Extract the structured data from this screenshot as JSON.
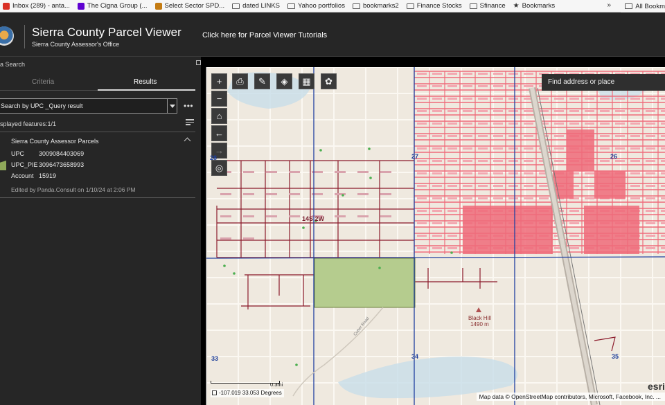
{
  "browser": {
    "bookmarks": [
      {
        "label": "Inbox (289) - anta...",
        "icon": "mail-icon",
        "color": "#d93025"
      },
      {
        "label": "The Cigna Group (...",
        "icon": "yahoo-icon",
        "color": "#5f01d1"
      },
      {
        "label": "Select Sector SPD...",
        "icon": "globe-icon",
        "color": "#c47b12"
      },
      {
        "label": "dated LINKS",
        "icon": "folder-icon",
        "color": "#555555"
      },
      {
        "label": "Yahoo portfolios",
        "icon": "folder-icon",
        "color": "#555555"
      },
      {
        "label": "bookmarks2",
        "icon": "folder-icon",
        "color": "#555555"
      },
      {
        "label": "Finance Stocks",
        "icon": "folder-icon",
        "color": "#555555"
      },
      {
        "label": "Sfinance",
        "icon": "folder-icon",
        "color": "#555555"
      },
      {
        "label": "Bookmarks",
        "icon": "star-icon",
        "color": "#333333"
      }
    ],
    "more_label": "»",
    "all_bookmarks_label": "All Bookm"
  },
  "header": {
    "title": "Sierra County Parcel Viewer",
    "subtitle": "Sierra County Assessor's Office",
    "tutorial_link": "Click here for Parcel Viewer Tutorials"
  },
  "panel": {
    "title": "a Search",
    "tabs": {
      "criteria": "Criteria",
      "results": "Results"
    },
    "select_value": "Search by UPC _Query result",
    "more_label": "•••",
    "features_label": "splayed features:1/1",
    "layer_name": "Sierra County Assessor Parcels",
    "attributes": [
      {
        "key": "UPC",
        "value": "3009084403069"
      },
      {
        "key": "UPC_PIE",
        "value": "3096473658993"
      },
      {
        "key": "Account",
        "value": "15919"
      }
    ],
    "edited": "Edited by Panda.Consult on 1/10/24 at 2:06 PM"
  },
  "map": {
    "find_placeholder": "Find address or place",
    "tools": [
      {
        "name": "zoom-in-button",
        "glyph": "+"
      },
      {
        "name": "zoom-out-button",
        "glyph": "−"
      },
      {
        "name": "home-button",
        "glyph": "⌂"
      },
      {
        "name": "back-button",
        "glyph": "←"
      },
      {
        "name": "forward-button",
        "glyph": "→"
      },
      {
        "name": "locate-button",
        "glyph": "◎"
      }
    ],
    "top_tools": [
      {
        "name": "print-button",
        "glyph": "⎙"
      },
      {
        "name": "measure-button",
        "glyph": "✎"
      },
      {
        "name": "layers-button",
        "glyph": "◈"
      },
      {
        "name": "basemap-gallery-button",
        "glyph": "▦"
      },
      {
        "name": "palette-button",
        "glyph": "✿"
      }
    ],
    "section_labels": [
      "28",
      "27",
      "26",
      "33",
      "34",
      "35"
    ],
    "township_label": "14S 2W",
    "peak": {
      "name": "Black Hill",
      "elevation": "1490 m"
    },
    "road_label": "Cutter Road",
    "scale_label": "0.3mi",
    "coordinates": "-107.019 33.053 Degrees",
    "attribution": "Map data © OpenStreetMap contributors, Microsoft, Facebook, Inc. ...",
    "logo_text": "esri",
    "colors": {
      "parcel_line": "#8b1a2b",
      "selected_parcel": "#b5cc8e",
      "section_line": "#2040a0",
      "dense_parcels": "#ef6b7a",
      "water": "#c8dde8"
    }
  }
}
